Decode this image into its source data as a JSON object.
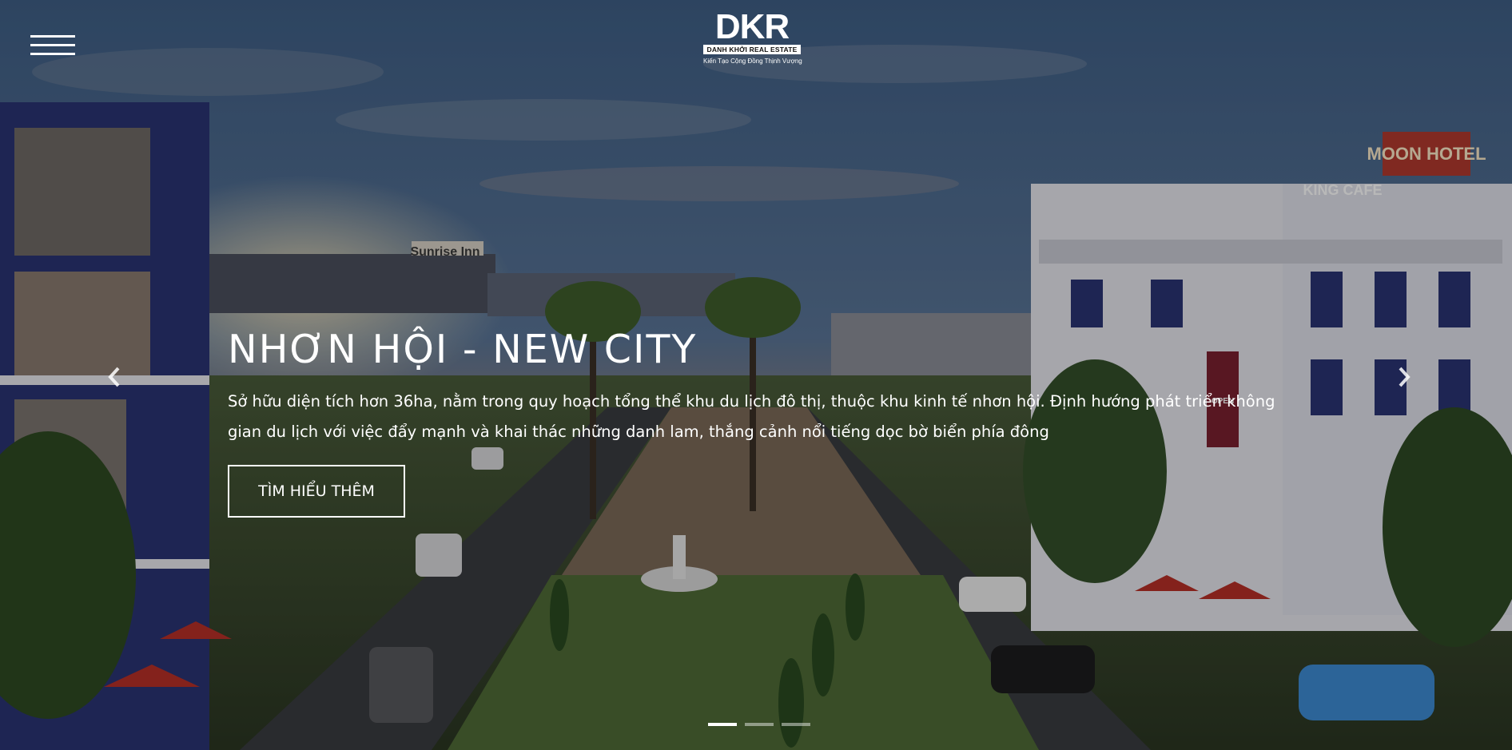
{
  "brand": {
    "mark": "DKR",
    "name": "DANH KHỞI REAL ESTATE",
    "tagline": "Kiến Tạo Cộng Đồng Thịnh Vượng"
  },
  "nav": {
    "menu_icon": "hamburger-menu-icon"
  },
  "scene_signs": {
    "hotel": "MOON HOTEL",
    "cafe": "KING CAFE",
    "inn": "Sunrise Inn",
    "shop": "OPEN"
  },
  "slide": {
    "title": "NHƠN HỘI - NEW CITY",
    "description": "Sở hữu diện tích hơn 36ha, nằm trong quy hoạch tổng thể khu du lịch đô thị, thuộc khu kinh tế nhơn hội. Định hướng phát triển không gian du lịch với việc đẩy mạnh và khai thác những danh lam, thắng cảnh nổi tiếng dọc bờ biển phía đông",
    "button_label": "TÌM HIỂU THÊM"
  },
  "carousel": {
    "prev_icon": "chevron-left-icon",
    "next_icon": "chevron-right-icon",
    "slide_count": 3,
    "active_index": 0
  },
  "colors": {
    "text": "#ffffff",
    "overlay": "rgba(0,0,0,0.28)",
    "building_accent": "#2f3a7a"
  }
}
